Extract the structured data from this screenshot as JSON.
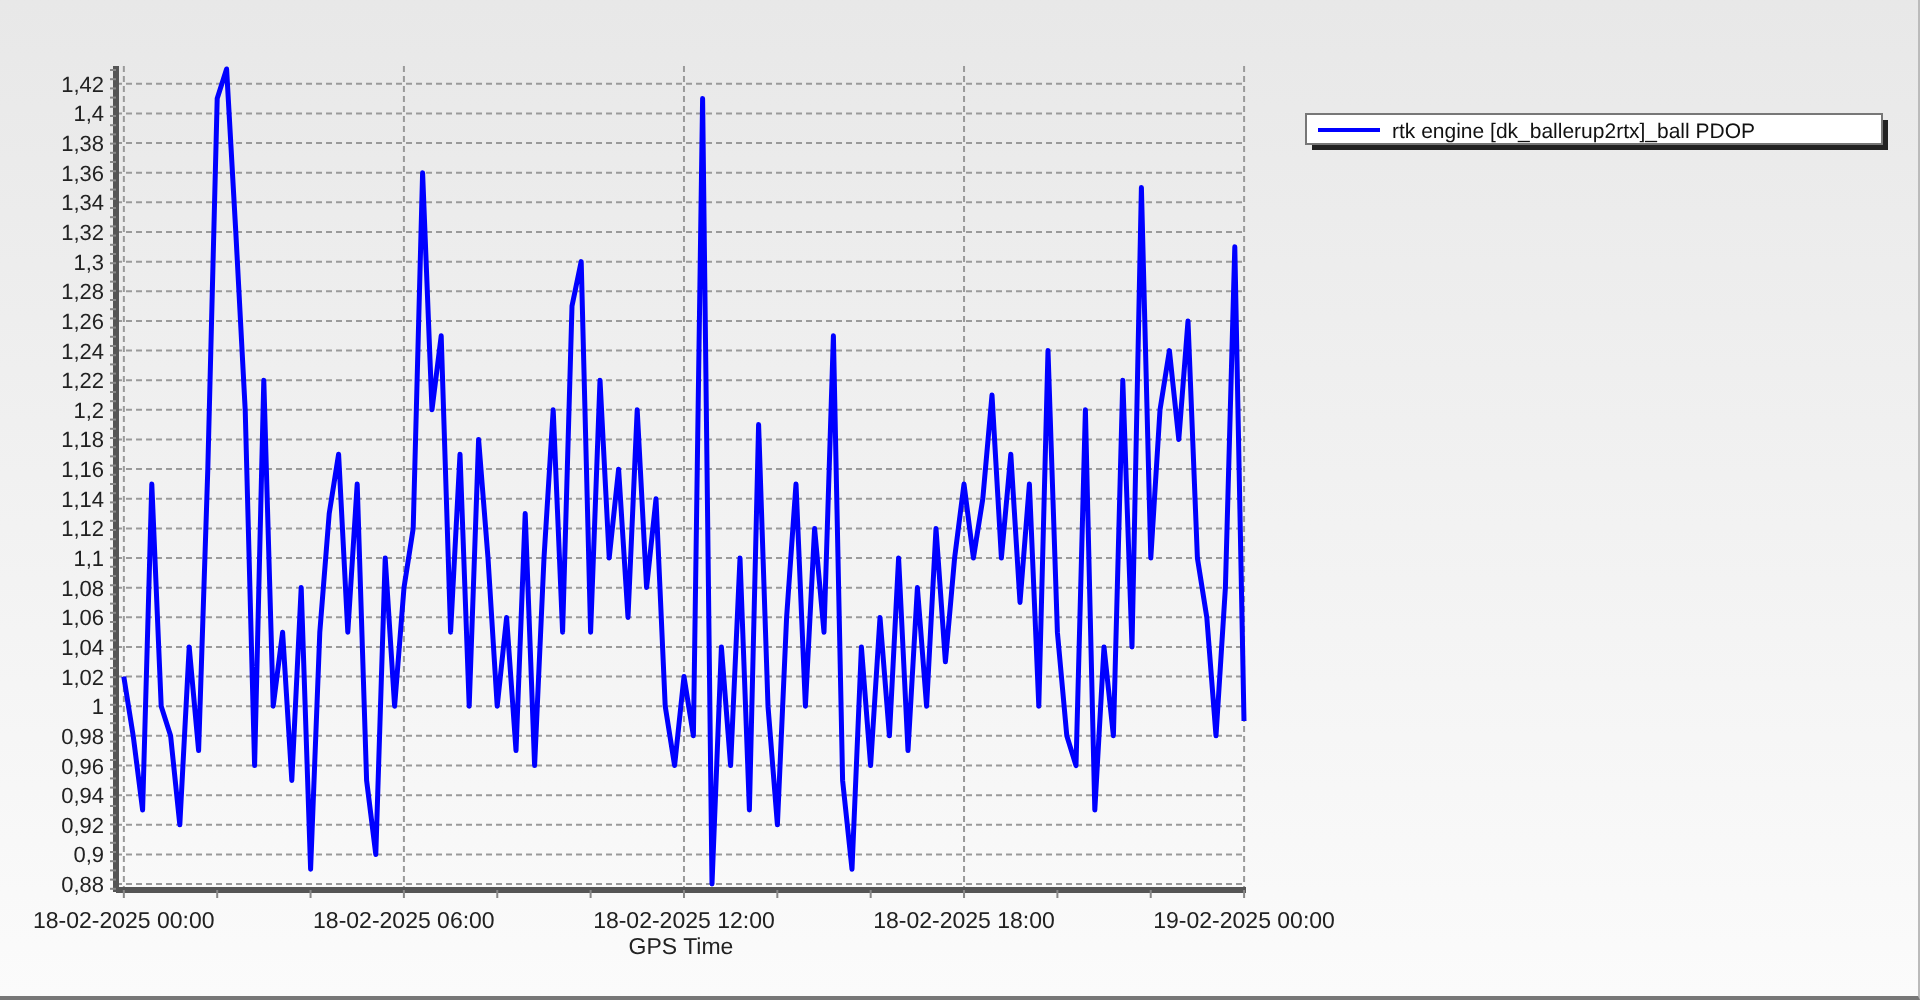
{
  "chart": {
    "chart_data": {
      "type": "line",
      "xlabel": "GPS Time",
      "grid": true,
      "ylim": [
        0.876,
        1.432
      ],
      "yticks": [
        {
          "value": 0.88,
          "label": "0,88"
        },
        {
          "value": 0.9,
          "label": "0,9"
        },
        {
          "value": 0.92,
          "label": "0,92"
        },
        {
          "value": 0.94,
          "label": "0,94"
        },
        {
          "value": 0.96,
          "label": "0,96"
        },
        {
          "value": 0.98,
          "label": "0,98"
        },
        {
          "value": 1,
          "label": "1"
        },
        {
          "value": 1.02,
          "label": "1,02"
        },
        {
          "value": 1.04,
          "label": "1,04"
        },
        {
          "value": 1.06,
          "label": "1,06"
        },
        {
          "value": 1.08,
          "label": "1,08"
        },
        {
          "value": 1.1,
          "label": "1,1"
        },
        {
          "value": 1.12,
          "label": "1,12"
        },
        {
          "value": 1.14,
          "label": "1,14"
        },
        {
          "value": 1.16,
          "label": "1,16"
        },
        {
          "value": 1.18,
          "label": "1,18"
        },
        {
          "value": 1.2,
          "label": "1,2"
        },
        {
          "value": 1.22,
          "label": "1,22"
        },
        {
          "value": 1.24,
          "label": "1,24"
        },
        {
          "value": 1.26,
          "label": "1,26"
        },
        {
          "value": 1.28,
          "label": "1,28"
        },
        {
          "value": 1.3,
          "label": "1,3"
        },
        {
          "value": 1.32,
          "label": "1,32"
        },
        {
          "value": 1.34,
          "label": "1,34"
        },
        {
          "value": 1.36,
          "label": "1,36"
        },
        {
          "value": 1.38,
          "label": "1,38"
        },
        {
          "value": 1.4,
          "label": "1,4"
        },
        {
          "value": 1.42,
          "label": "1,42"
        }
      ],
      "categories": [
        "18-02-2025 00:00",
        null,
        null,
        null,
        null,
        null,
        null,
        null,
        null,
        null,
        null,
        null,
        null,
        null,
        null,
        null,
        null,
        null,
        null,
        null,
        null,
        null,
        null,
        null,
        null,
        null,
        null,
        null,
        null,
        null,
        "18-02-2025 06:00",
        null,
        null,
        null,
        null,
        null,
        null,
        null,
        null,
        null,
        null,
        null,
        null,
        null,
        null,
        null,
        null,
        null,
        null,
        null,
        null,
        null,
        null,
        null,
        null,
        null,
        null,
        null,
        null,
        null,
        "18-02-2025 12:00",
        null,
        null,
        null,
        null,
        null,
        null,
        null,
        null,
        null,
        null,
        null,
        null,
        null,
        null,
        null,
        null,
        null,
        null,
        null,
        null,
        null,
        null,
        null,
        null,
        null,
        null,
        null,
        null,
        null,
        "18-02-2025 18:00",
        null,
        null,
        null,
        null,
        null,
        null,
        null,
        null,
        null,
        null,
        null,
        null,
        null,
        null,
        null,
        null,
        null,
        null,
        null,
        null,
        null,
        null,
        null,
        null,
        null,
        null,
        null,
        null,
        null,
        "19-02-2025 00:00"
      ],
      "series": [
        {
          "name": "rtk engine [dk_ballerup2rtx]_ball PDOP",
          "color": "#0000ff",
          "values": [
            1.02,
            0.98,
            0.93,
            1.15,
            1.0,
            0.98,
            0.92,
            1.04,
            0.97,
            1.16,
            1.41,
            1.43,
            1.32,
            1.2,
            0.96,
            1.22,
            1.0,
            1.05,
            0.95,
            1.08,
            0.89,
            1.05,
            1.13,
            1.17,
            1.05,
            1.15,
            0.95,
            0.9,
            1.1,
            1.0,
            1.08,
            1.12,
            1.36,
            1.2,
            1.25,
            1.05,
            1.17,
            1.0,
            1.18,
            1.1,
            1.0,
            1.06,
            0.97,
            1.13,
            0.96,
            1.1,
            1.2,
            1.05,
            1.27,
            1.3,
            1.05,
            1.22,
            1.1,
            1.16,
            1.06,
            1.2,
            1.08,
            1.14,
            1.0,
            0.96,
            1.02,
            0.98,
            1.41,
            0.88,
            1.04,
            0.96,
            1.1,
            0.93,
            1.19,
            1.0,
            0.92,
            1.06,
            1.15,
            1.0,
            1.12,
            1.05,
            1.25,
            0.95,
            0.89,
            1.04,
            0.96,
            1.06,
            0.98,
            1.1,
            0.97,
            1.08,
            1.0,
            1.12,
            1.03,
            1.1,
            1.15,
            1.1,
            1.14,
            1.21,
            1.1,
            1.17,
            1.07,
            1.15,
            1.0,
            1.24,
            1.05,
            0.98,
            0.96,
            1.2,
            0.93,
            1.04,
            0.98,
            1.22,
            1.04,
            1.35,
            1.1,
            1.2,
            1.24,
            1.18,
            1.26,
            1.1,
            1.06,
            0.98,
            1.08,
            1.31,
            0.99
          ]
        }
      ]
    }
  }
}
